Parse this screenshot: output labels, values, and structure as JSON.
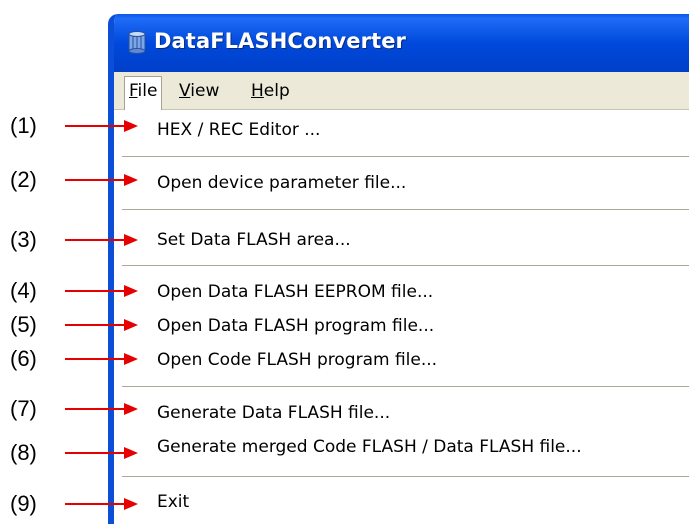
{
  "window": {
    "title": "DataFLASHConverter"
  },
  "menubar": {
    "items": [
      {
        "mnemonic": "F",
        "rest": "ile"
      },
      {
        "mnemonic": "V",
        "rest": "iew"
      },
      {
        "mnemonic": "H",
        "rest": "elp"
      }
    ]
  },
  "file_menu": {
    "items": [
      "HEX / REC Editor ...",
      "Open device parameter file...",
      "Set Data FLASH area...",
      "Open Data FLASH EEPROM file...",
      "Open Data FLASH program file...",
      "Open Code FLASH program file...",
      "Generate Data FLASH file...",
      "Generate merged Code FLASH / Data FLASH file...",
      "Exit"
    ]
  },
  "callouts": [
    "(1)",
    "(2)",
    "(3)",
    "(4)",
    "(5)",
    "(6)",
    "(7)",
    "(8)",
    "(9)"
  ],
  "colors": {
    "title_bar": "#0049dc",
    "menu_bg": "#ece9d8",
    "callout_arrow": "#e60000"
  },
  "icons": {
    "app_icon": "blue-cylinder-app-icon"
  }
}
